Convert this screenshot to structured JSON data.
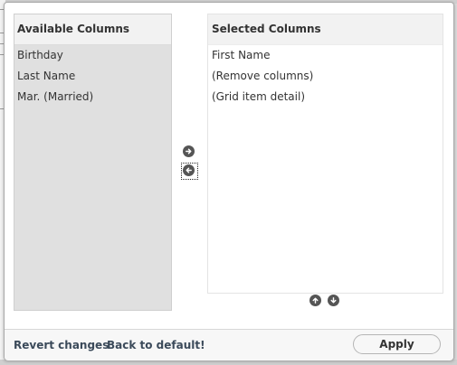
{
  "available": {
    "title": "Available Columns",
    "items": [
      "Birthday",
      "Last Name",
      "Mar. (Married)"
    ]
  },
  "selected": {
    "title": "Selected Columns",
    "items": [
      "First Name",
      "(Remove columns)",
      "(Grid item detail)"
    ]
  },
  "controls": {
    "move_right_icon": "arrow-right-circle",
    "move_left_icon": "arrow-left-circle",
    "move_up_icon": "arrow-up-circle",
    "move_down_icon": "arrow-down-circle"
  },
  "footer": {
    "revert_label": "Revert changes",
    "default_label": "Back to default!",
    "apply_label": "Apply"
  },
  "colors": {
    "panel_gray": "#e0e0e0",
    "header_gray": "#f2f2f2",
    "text": "#333333",
    "icon": "#555555"
  }
}
